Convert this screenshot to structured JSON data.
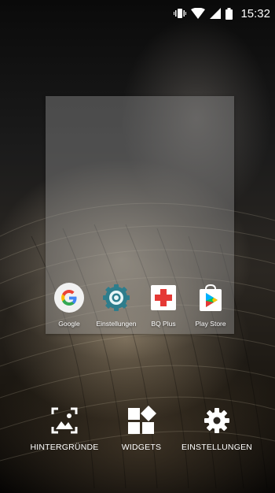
{
  "status_bar": {
    "time": "15:32",
    "icons": [
      "vibrate-icon",
      "wifi-icon",
      "cellular-signal-icon",
      "battery-icon"
    ]
  },
  "preview": {
    "apps": [
      {
        "label": "Google",
        "icon": "google-icon"
      },
      {
        "label": "Einstellungen",
        "icon": "settings-app-icon"
      },
      {
        "label": "BQ Plus",
        "icon": "bq-plus-icon"
      },
      {
        "label": "Play Store",
        "icon": "play-store-icon"
      }
    ]
  },
  "options": {
    "wallpapers": {
      "label": "HINTERGRÜNDE",
      "icon": "wallpaper-icon"
    },
    "widgets": {
      "label": "WIDGETS",
      "icon": "widgets-icon"
    },
    "settings": {
      "label": "EINSTELLUNGEN",
      "icon": "gear-icon"
    }
  },
  "colors": {
    "google_red": "#EA4335",
    "google_blue": "#4285F4",
    "google_yellow": "#FBBC05",
    "google_green": "#34A853",
    "settings_teal": "#2E7D8C",
    "bq_red": "#E53935"
  }
}
